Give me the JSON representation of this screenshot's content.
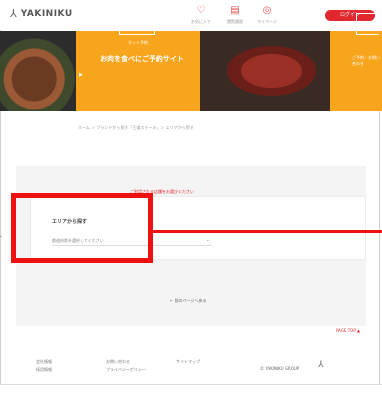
{
  "header": {
    "logo_mark": "⅄",
    "logo_text": "YAKINIKU",
    "nav": [
      {
        "icon": "♡",
        "label": "お気に入り"
      },
      {
        "icon": "▤",
        "label": "閲覧履歴"
      },
      {
        "icon": "◎",
        "label": "マイページ"
      }
    ],
    "button_label": "ログイン"
  },
  "banner": {
    "brand": "王道",
    "sub": "ネット予約",
    "main": "お肉を食べにご予約サイト",
    "arrow": "▶",
    "caption2": "ご予約・お問い合わせ"
  },
  "breadcrumb": "ホーム ＞ ブランドから探す「王道ステーキ」＞ エリアから探す",
  "notice": "ご利用される店舗をお選びください",
  "card": {
    "title": "エリアから探す",
    "select_value": "都道府県を選択してください",
    "chevron": "⌄"
  },
  "hl_tick": "-",
  "back_link": "← 前のページへ戻る",
  "pagetop": "PAGE TOP ▲",
  "footer": {
    "col1": [
      "会社情報",
      "採用情報"
    ],
    "col2": [
      "お問い合わせ",
      "プライバシーポリシー"
    ],
    "col3": [
      "サイトマップ"
    ],
    "brand_text": "© YAKINIKU GROUP",
    "logo": "⅄"
  },
  "colors": {
    "accent": "#e0282e",
    "banner_yellow": "#f7a51c",
    "highlight": "#ee1111",
    "panel_bg": "#f4f4f4"
  }
}
